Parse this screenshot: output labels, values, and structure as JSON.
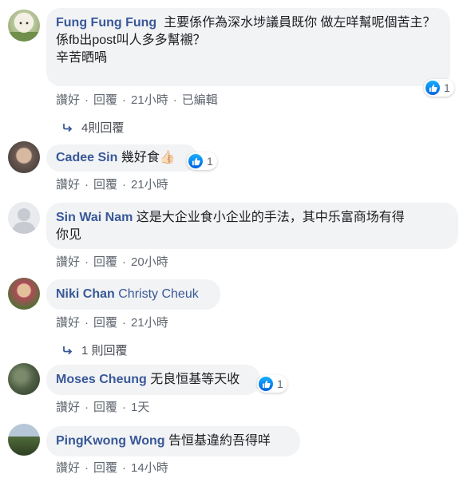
{
  "comments": [
    {
      "author": "Fung Fung Fung",
      "text": "主要係作為深水埗議員既你 做左咩幫呢個苦主？",
      "text_line2": "係fb出post叫人多多幫襯？",
      "text_line3": "辛苦晒喎",
      "reactions": "1",
      "like": "讚好",
      "reply": "回覆",
      "time": "21小時",
      "edited": "已編輯",
      "replies_label": "4則回覆"
    },
    {
      "author": "Cadee Sin",
      "text": "幾好食👍🏻",
      "reactions": "1",
      "like": "讚好",
      "reply": "回覆",
      "time": "21小時"
    },
    {
      "author": "Sin Wai Nam",
      "text": "这是大企业食小企业的手法，其中乐富商场有得",
      "text_line2": "你见",
      "like": "讚好",
      "reply": "回覆",
      "time": "20小時"
    },
    {
      "author": "Niki Chan",
      "tag": "Christy Cheuk",
      "like": "讚好",
      "reply": "回覆",
      "time": "21小時",
      "replies_label": "1 則回覆"
    },
    {
      "author": "Moses Cheung",
      "text": "无良恒基等天收",
      "reactions": "1",
      "like": "讚好",
      "reply": "回覆",
      "time": "1天"
    },
    {
      "author": "PingKwong Wong",
      "text": "告恒基違約吾得咩",
      "like": "讚好",
      "reply": "回覆",
      "time": "14小時"
    }
  ],
  "colors": {
    "author": "#385898",
    "bubble": "#f2f3f5",
    "like_blue": "#0062df"
  }
}
